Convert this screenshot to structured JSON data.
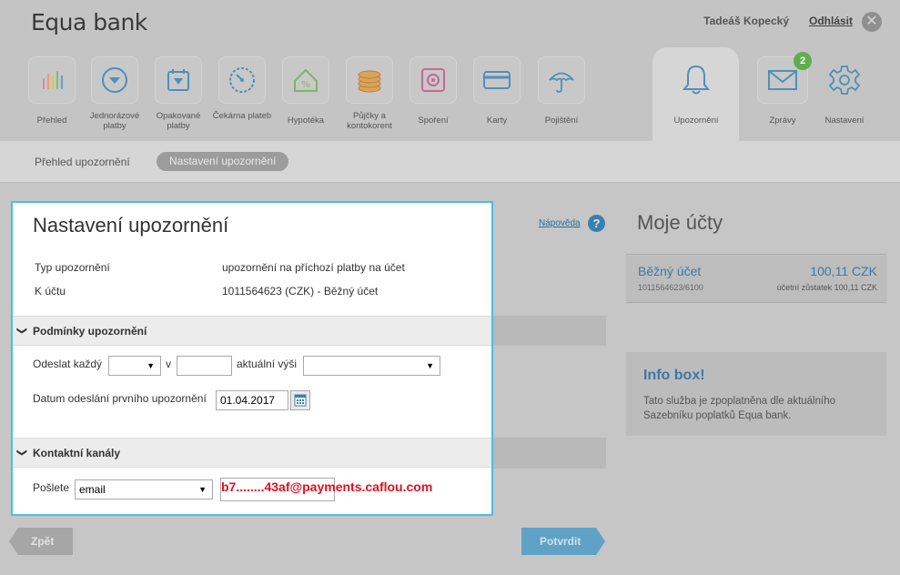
{
  "header": {
    "logo": "Equa bank",
    "user_name": "Tadeáš Kopecký",
    "logout": "Odhlásit",
    "close_symbol": "✕"
  },
  "nav": {
    "items": [
      {
        "label": "Přehled",
        "icon": "bar-chart-icon"
      },
      {
        "label": "Jednorázové platby",
        "icon": "arrow-down-circle-icon"
      },
      {
        "label": "Opakované platby",
        "icon": "calendar-arrow-icon"
      },
      {
        "label": "Čekárna plateb",
        "icon": "clock-gauge-icon"
      },
      {
        "label": "Hypotéka",
        "icon": "house-percent-icon"
      },
      {
        "label": "Půjčky a kontokorent",
        "icon": "coins-icon"
      },
      {
        "label": "Spoření",
        "icon": "safe-icon"
      },
      {
        "label": "Karty",
        "icon": "card-icon"
      },
      {
        "label": "Pojištění",
        "icon": "umbrella-icon"
      }
    ],
    "right": [
      {
        "label": "Upozornění",
        "icon": "bell-icon"
      },
      {
        "label": "Zprávy",
        "icon": "envelope-icon"
      },
      {
        "label": "Nastavení",
        "icon": "gear-icon"
      }
    ],
    "messages_badge": "2"
  },
  "subnav": {
    "tab1": "Přehled upozornění",
    "tab2": "Nastavení upozornění"
  },
  "modal": {
    "title": "Nastavení upozornění",
    "type_label": "Typ upozornění",
    "type_value": "upozornění na příchozí platby na účet",
    "account_label": "K účtu",
    "account_value": "1011564623 (CZK) - Běžný účet",
    "conditions_header": "Podmínky upozornění",
    "send_every_label": "Odeslat každý",
    "send_every_value": "",
    "at_label": "v",
    "at_value": "",
    "current_amount_label": "aktuální výši",
    "current_amount_value": "",
    "first_date_label": "Datum odeslání prvního upozornění",
    "first_date_value": "01.04.2017",
    "contacts_header": "Kontaktní kanály",
    "send_label": "Pošlete",
    "channel_value": "email",
    "email_value": "b7........43af@payments.caflou.com"
  },
  "help": {
    "link": "Nápověda",
    "symbol": "?"
  },
  "accounts": {
    "title": "Moje účty",
    "name": "Běžný účet",
    "amount": "100,11 CZK",
    "number": "1011564623/6100",
    "balance": "účetní zůstatek 100,11 CZK"
  },
  "infobox": {
    "title": "Info box!",
    "text": "Tato služba je zpoplatněna dle aktuálního Sazebníku poplatků Equa bank."
  },
  "buttons": {
    "back": "Zpět",
    "confirm": "Potvrdit"
  },
  "colors": {
    "accent": "#4dbde6",
    "link": "#3b78a6",
    "badge": "#5fae4e",
    "email_text": "#e01020"
  }
}
